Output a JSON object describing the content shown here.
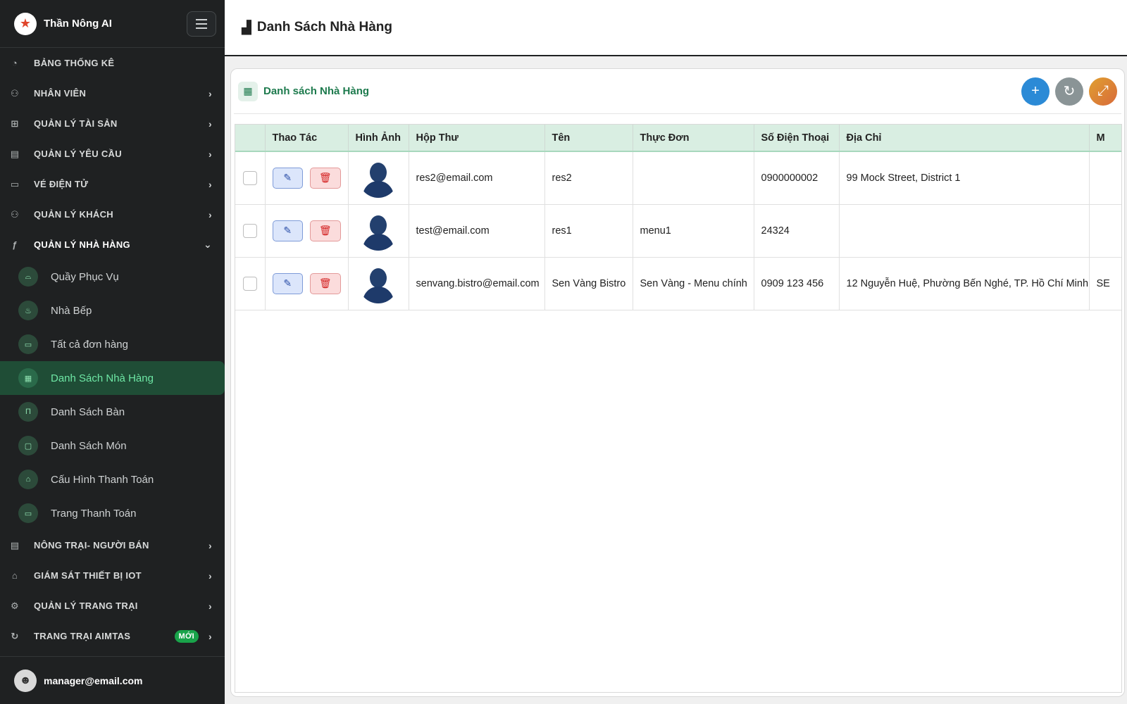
{
  "brand": {
    "name": "Thần Nông AI"
  },
  "sidebar": {
    "items_top": [
      {
        "label": "BẢNG THỐNG KÊ",
        "icon": "dashboard-icon",
        "chevron": false
      },
      {
        "label": "NHÂN VIÊN",
        "icon": "employees-icon",
        "chevron": true
      },
      {
        "label": "QUẢN LÝ TÀI SẢN",
        "icon": "assets-icon",
        "chevron": true
      },
      {
        "label": "QUẢN LÝ YÊU CẦU",
        "icon": "requests-icon",
        "chevron": true
      },
      {
        "label": "VÉ ĐIỆN TỬ",
        "icon": "ticket-icon",
        "chevron": true
      },
      {
        "label": "QUẢN LÝ KHÁCH",
        "icon": "guests-icon",
        "chevron": true
      },
      {
        "label": "QUẢN LÝ NHÀ HÀNG",
        "icon": "restaurant-icon",
        "chevron": true
      }
    ],
    "sub_items": [
      {
        "label": "Quầy Phục Vụ",
        "icon": "counter-icon"
      },
      {
        "label": "Nhà Bếp",
        "icon": "kitchen-icon"
      },
      {
        "label": "Tất cả đơn hàng",
        "icon": "orders-icon"
      },
      {
        "label": "Danh Sách Nhà Hàng",
        "icon": "store-icon"
      },
      {
        "label": "Danh Sách Bàn",
        "icon": "table-icon"
      },
      {
        "label": "Danh Sách Món",
        "icon": "dish-icon"
      },
      {
        "label": "Cấu Hình Thanh Toán",
        "icon": "payment-config-icon"
      },
      {
        "label": "Trang Thanh Toán",
        "icon": "payment-page-icon"
      }
    ],
    "items_bottom": [
      {
        "label": "NÔNG TRẠI- NGƯỜI BÁN",
        "icon": "farm-seller-icon"
      },
      {
        "label": "GIÁM SÁT THIẾT BỊ IOT",
        "icon": "iot-icon"
      },
      {
        "label": "QUẢN LÝ TRANG TRẠI",
        "icon": "farm-icon"
      },
      {
        "label": "TRANG TRẠI AIMTAS",
        "icon": "aimtas-icon",
        "badge": "MỚI"
      }
    ],
    "footer_email": "manager@email.com"
  },
  "header": {
    "title": "Danh Sách Nhà Hàng"
  },
  "card": {
    "title": "Danh sách Nhà Hàng"
  },
  "table": {
    "columns": [
      "Thao Tác",
      "Hình Ảnh",
      "Hộp Thư",
      "Tên",
      "Thực Đơn",
      "Số Điện Thoại",
      "Địa Chỉ",
      "M"
    ],
    "rows": [
      {
        "email": "res2@email.com",
        "name": "res2",
        "menu": "",
        "phone": "0900000002",
        "address": "99 Mock Street, District 1",
        "extra": ""
      },
      {
        "email": "test@email.com",
        "name": "res1",
        "menu": "menu1",
        "phone": "24324",
        "address": "",
        "extra": ""
      },
      {
        "email": "senvang.bistro@email.com",
        "name": "Sen Vàng Bistro",
        "menu": "Sen Vàng - Menu chính",
        "phone": "0909 123 456",
        "address": "12 Nguyễn Huệ, Phường Bến Nghé, TP. Hồ Chí Minh",
        "extra": "SE"
      }
    ]
  }
}
